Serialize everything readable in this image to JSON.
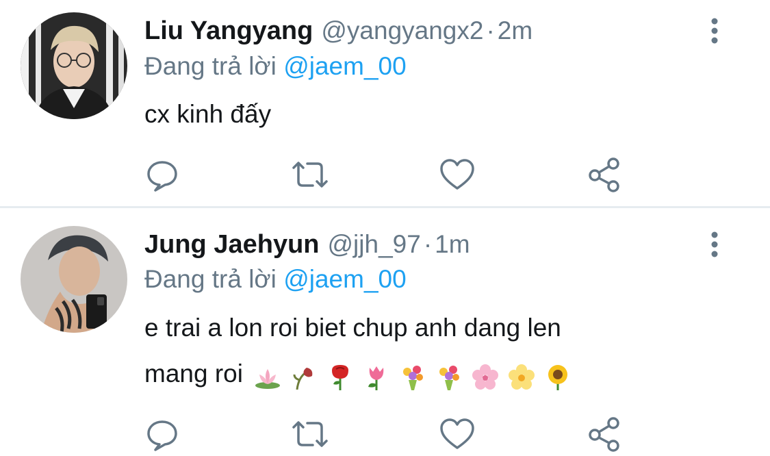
{
  "tweets": [
    {
      "display_name": "Liu Yangyang",
      "handle": "@yangyangx2",
      "separator": "·",
      "time": "2m",
      "reply_prefix": "Đang trả lời",
      "reply_to": "@jaem_00",
      "text": "cx kinh đấy",
      "text_line2": "",
      "icons": {
        "more": "more-vertical-icon",
        "reply": "reply-icon",
        "retweet": "retweet-icon",
        "like": "heart-icon",
        "share": "share-icon"
      }
    },
    {
      "display_name": "Jung Jaehyun",
      "handle": "@jjh_97",
      "separator": "·",
      "time": "1m",
      "reply_prefix": "Đang trả lời",
      "reply_to": "@jaem_00",
      "text": "e trai a lon roi biet chup anh dang len",
      "text_line2": "mang roi",
      "emojis": [
        "lotus",
        "wilted-flower",
        "rose",
        "tulip",
        "bouquet",
        "bouquet",
        "cherry-blossom",
        "blossom",
        "sunflower"
      ],
      "icons": {
        "more": "more-vertical-icon",
        "reply": "reply-icon",
        "retweet": "retweet-icon",
        "like": "heart-icon",
        "share": "share-icon"
      }
    }
  ],
  "colors": {
    "text_primary": "#14171a",
    "text_secondary": "#657786",
    "link": "#1da1f2",
    "divider": "#e6ecf0",
    "icon": "#657786"
  }
}
